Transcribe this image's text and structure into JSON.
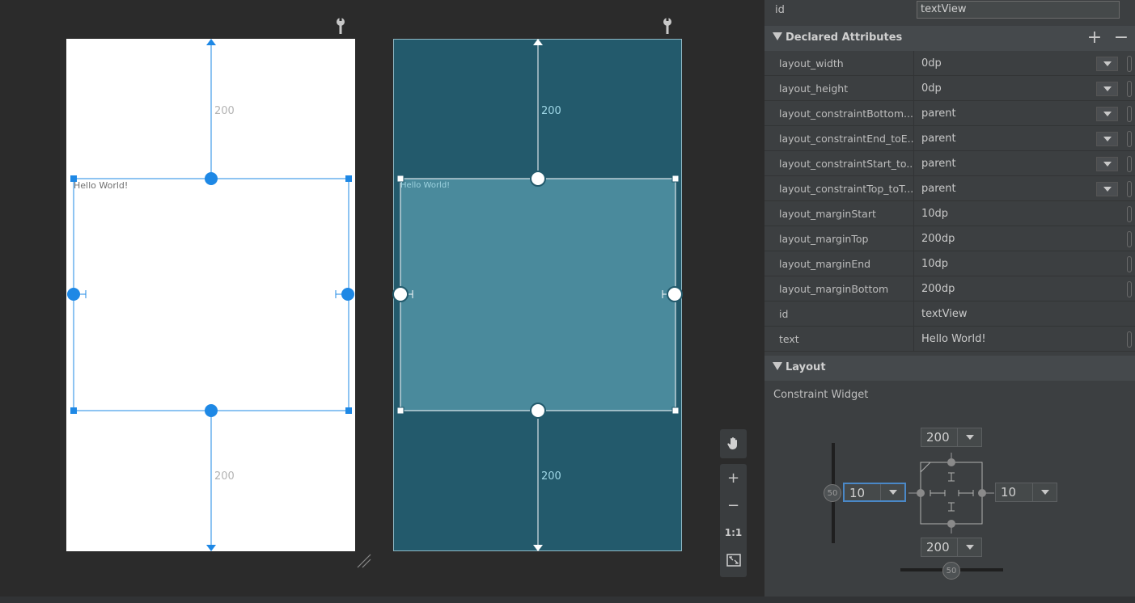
{
  "canvas": {
    "design_text": "Hello World!",
    "blueprint_text": "Hello World!",
    "margin_top_label": "200",
    "margin_bottom_label": "200"
  },
  "zoom": {
    "zoom_in": "+",
    "zoom_out": "−",
    "actual_size": "1:1"
  },
  "panel": {
    "id_label": "id",
    "id_value": "textView",
    "declared_title": "Declared Attributes",
    "add_label": "+",
    "remove_label": "−",
    "attributes": [
      {
        "name": "layout_width",
        "value": "0dp"
      },
      {
        "name": "layout_height",
        "value": "0dp"
      },
      {
        "name": "layout_constraintBottom...",
        "value": "parent"
      },
      {
        "name": "layout_constraintEnd_toE...",
        "value": "parent"
      },
      {
        "name": "layout_constraintStart_to...",
        "value": "parent"
      },
      {
        "name": "layout_constraintTop_toT...",
        "value": "parent"
      },
      {
        "name": "layout_marginStart",
        "value": "10dp"
      },
      {
        "name": "layout_marginTop",
        "value": "200dp"
      },
      {
        "name": "layout_marginEnd",
        "value": "10dp"
      },
      {
        "name": "layout_marginBottom",
        "value": "200dp"
      },
      {
        "name": "id",
        "value": "textView"
      },
      {
        "name": "text",
        "value": "Hello World!"
      }
    ],
    "layout_title": "Layout",
    "constraint_widget_label": "Constraint Widget",
    "widget": {
      "top_margin": "200",
      "bottom_margin": "200",
      "start_margin": "10",
      "end_margin": "10",
      "vertical_bias": "50",
      "horizontal_bias": "50"
    }
  },
  "colors": {
    "accent_blue": "#1e88e5",
    "blueprint_bg": "#235a6c",
    "blueprint_widget": "#4a8a9c"
  }
}
